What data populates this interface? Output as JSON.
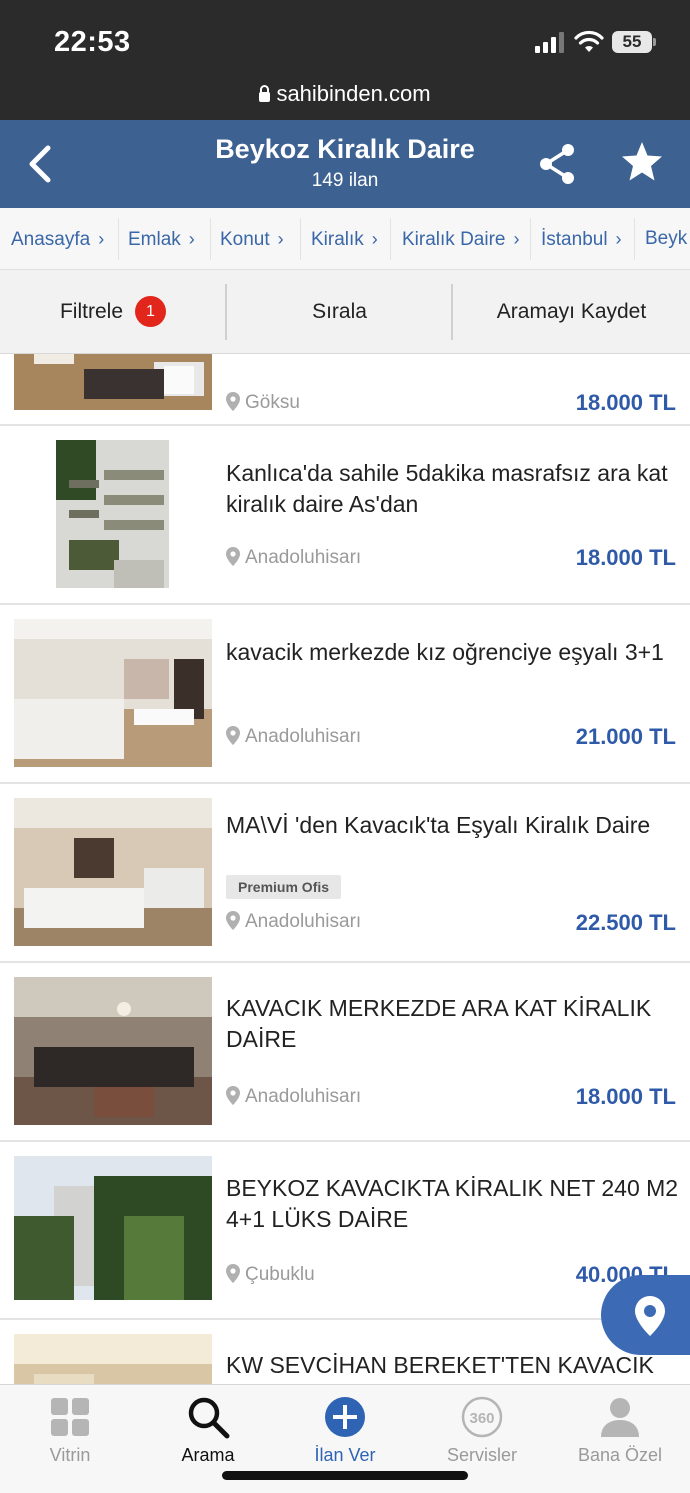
{
  "status_bar": {
    "time": "22:53",
    "battery": "55"
  },
  "browser": {
    "url": "sahibinden.com"
  },
  "header": {
    "title": "Beykoz Kiralık Daire",
    "subtitle": "149 ilan",
    "back_icon": "chevron-left-icon",
    "share_icon": "share-icon",
    "favorite_icon": "star-icon"
  },
  "breadcrumb": [
    "Anasayfa",
    "Emlak",
    "Konut",
    "Kiralık",
    "Kiralık Daire",
    "İstanbul",
    "Beyk"
  ],
  "filters": {
    "filter_label": "Filtrele",
    "filter_count": "1",
    "sort_label": "Sırala",
    "save_search_label": "Aramayı Kaydet"
  },
  "listings": [
    {
      "title": "",
      "location": "Göksu",
      "price": "18.000 TL",
      "badge": ""
    },
    {
      "title": "Kanlıca'da sahile 5dakika masrafsız ara kat kiralık daire As'dan",
      "location": "Anadoluhisarı",
      "price": "18.000 TL",
      "badge": ""
    },
    {
      "title": "kavacik merkezde kız oğrenciye eşyalı 3+1",
      "location": "Anadoluhisarı",
      "price": "21.000 TL",
      "badge": ""
    },
    {
      "title": "MA\\Vİ 'den Kavacık'ta Eşyalı Kiralık Daire",
      "location": "Anadoluhisarı",
      "price": "22.500 TL",
      "badge": "Premium Ofis"
    },
    {
      "title": "KAVACIK MERKEZDE ARA KAT KİRALIK DAİRE",
      "location": "Anadoluhisarı",
      "price": "18.000 TL",
      "badge": ""
    },
    {
      "title": "BEYKOZ KAVACIKTA KİRALIK NET 240 M2 4+1 LÜKS DAİRE",
      "location": "Çubuklu",
      "price": "40.000 TL",
      "badge": ""
    },
    {
      "title": "KW SEVCİHAN BEREKET'TEN KAVACIK",
      "location": "",
      "price": "",
      "badge": ""
    }
  ],
  "tabbar": [
    {
      "label": "Vitrin",
      "icon": "grid-icon"
    },
    {
      "label": "Arama",
      "icon": "search-icon"
    },
    {
      "label": "İlan Ver",
      "icon": "plus-circle-icon"
    },
    {
      "label": "Servisler",
      "icon": "360-icon"
    },
    {
      "label": "Bana Özel",
      "icon": "user-icon"
    }
  ],
  "colors": {
    "brand_blue": "#3d6191",
    "price_blue": "#2f5aa8",
    "badge_red": "#e3261c"
  }
}
